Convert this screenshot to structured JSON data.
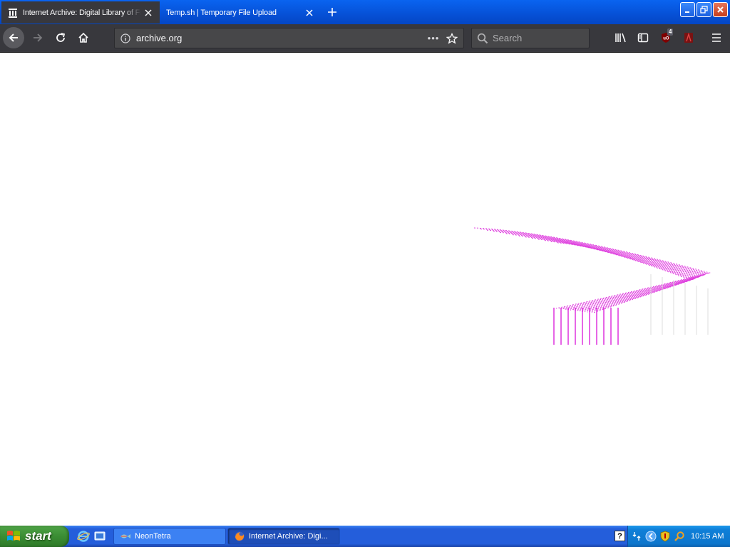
{
  "browser": {
    "tabs": [
      {
        "title": "Internet Archive: Digital Library of Free & Borrowable Books, Movies, Music & Wayback Machine",
        "active": true
      },
      {
        "title": "Temp.sh | Temporary File Upload",
        "active": false
      }
    ],
    "url": "archive.org",
    "search_placeholder": "Search",
    "ublock_badge": "4",
    "page_actions_label": "•••"
  },
  "taskbar": {
    "start_label": "start",
    "tasks": [
      {
        "label": "NeonTetra",
        "active": false
      },
      {
        "label": "Internet Archive: Digi...",
        "active": true
      }
    ],
    "help_label": "?",
    "clock": "10:15 AM"
  },
  "colors": {
    "tab_strip": "#0650d6",
    "toolbar": "#38383d",
    "loader_magenta": "#d400d4"
  }
}
